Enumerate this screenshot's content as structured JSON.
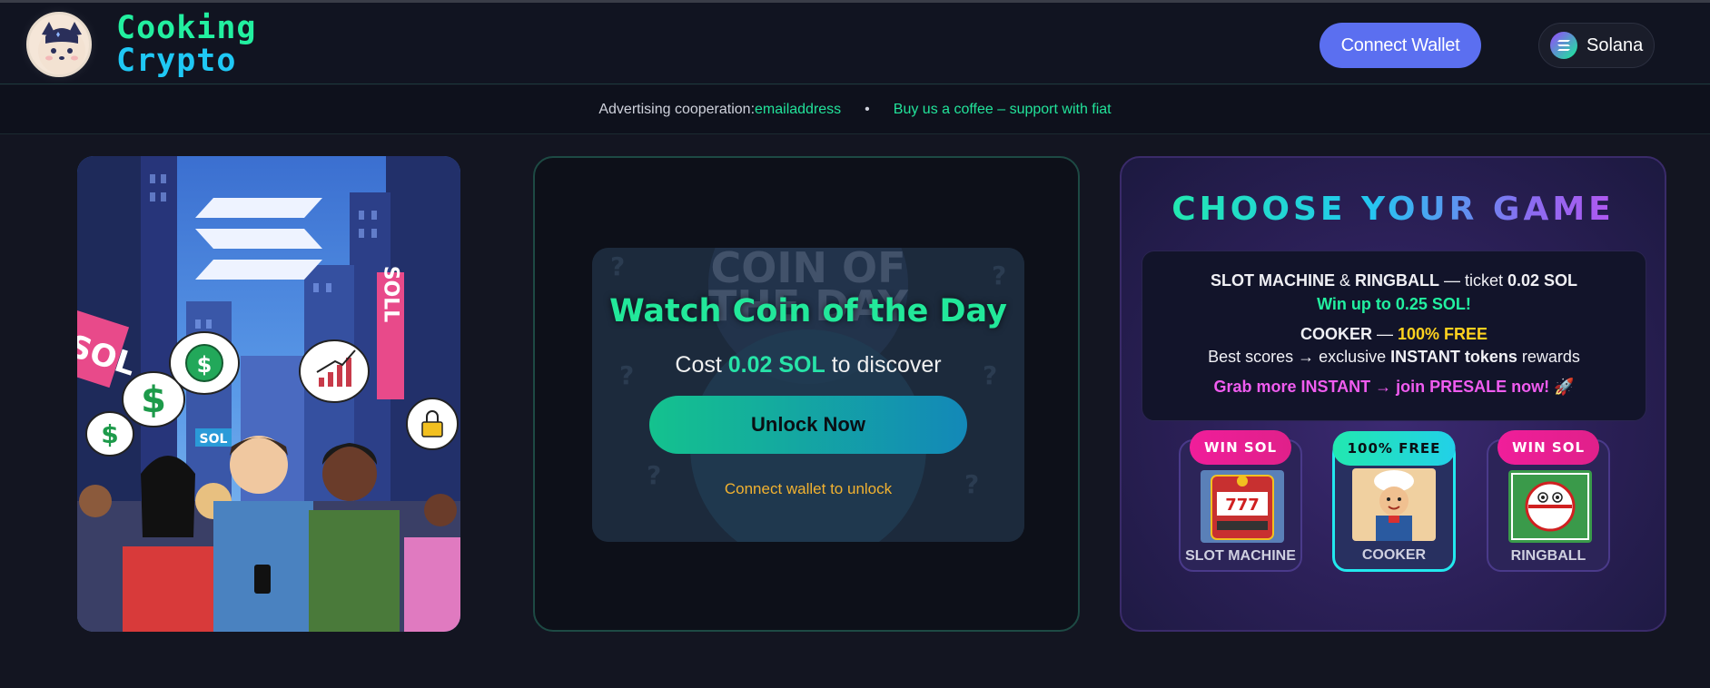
{
  "header": {
    "brand_line1": "Cooking",
    "brand_line2": "Crypto",
    "connect_wallet": "Connect Wallet",
    "chain_label": "Solana"
  },
  "announcement": {
    "prefix": "Advertising cooperation: ",
    "email": "emailaddress",
    "separator": "•",
    "coffee_link": "Buy us a coffee – support with fiat"
  },
  "art": {
    "sign_left": "SOL",
    "sign_right": "SOLL",
    "sign_small": "SOL",
    "bubble_dollar": "$"
  },
  "coin_of_day": {
    "bg_text_1": "COIN OF",
    "bg_text_2": "THE DAY",
    "title": "Watch Coin of the Day",
    "cost_prefix": "Cost ",
    "cost_amount": "0.02 SOL",
    "cost_suffix": " to discover",
    "unlock_label": "Unlock Now",
    "hint": "Connect wallet to unlock"
  },
  "games": {
    "title": "CHOOSE YOUR GAME",
    "line1_a": "SLOT MACHINE",
    "line1_b": " & ",
    "line1_c": "RINGBALL",
    "line1_d": " — ticket ",
    "line1_e": "0.02 SOL",
    "line2": "Win up to 0.25 SOL!",
    "line3_a": "COOKER",
    "line3_b": " — ",
    "line3_c": "100% FREE",
    "line4_a": "Best scores → exclusive ",
    "line4_b": "INSTANT tokens",
    "line4_c": " rewards",
    "line5": "Grab more INSTANT → join PRESALE now! 🚀",
    "tiles": [
      {
        "badge": "WIN SOL",
        "label": "SLOT MACHINE"
      },
      {
        "badge": "100% FREE",
        "label": "COOKER"
      },
      {
        "badge": "WIN SOL",
        "label": "RINGBALL"
      }
    ]
  },
  "colors": {
    "accent_green": "#22f0a0",
    "accent_blue": "#1fc8f5",
    "wallet_button": "#5b6ff0",
    "warning": "#f2b230",
    "badge_pink": "#f01e9a"
  }
}
